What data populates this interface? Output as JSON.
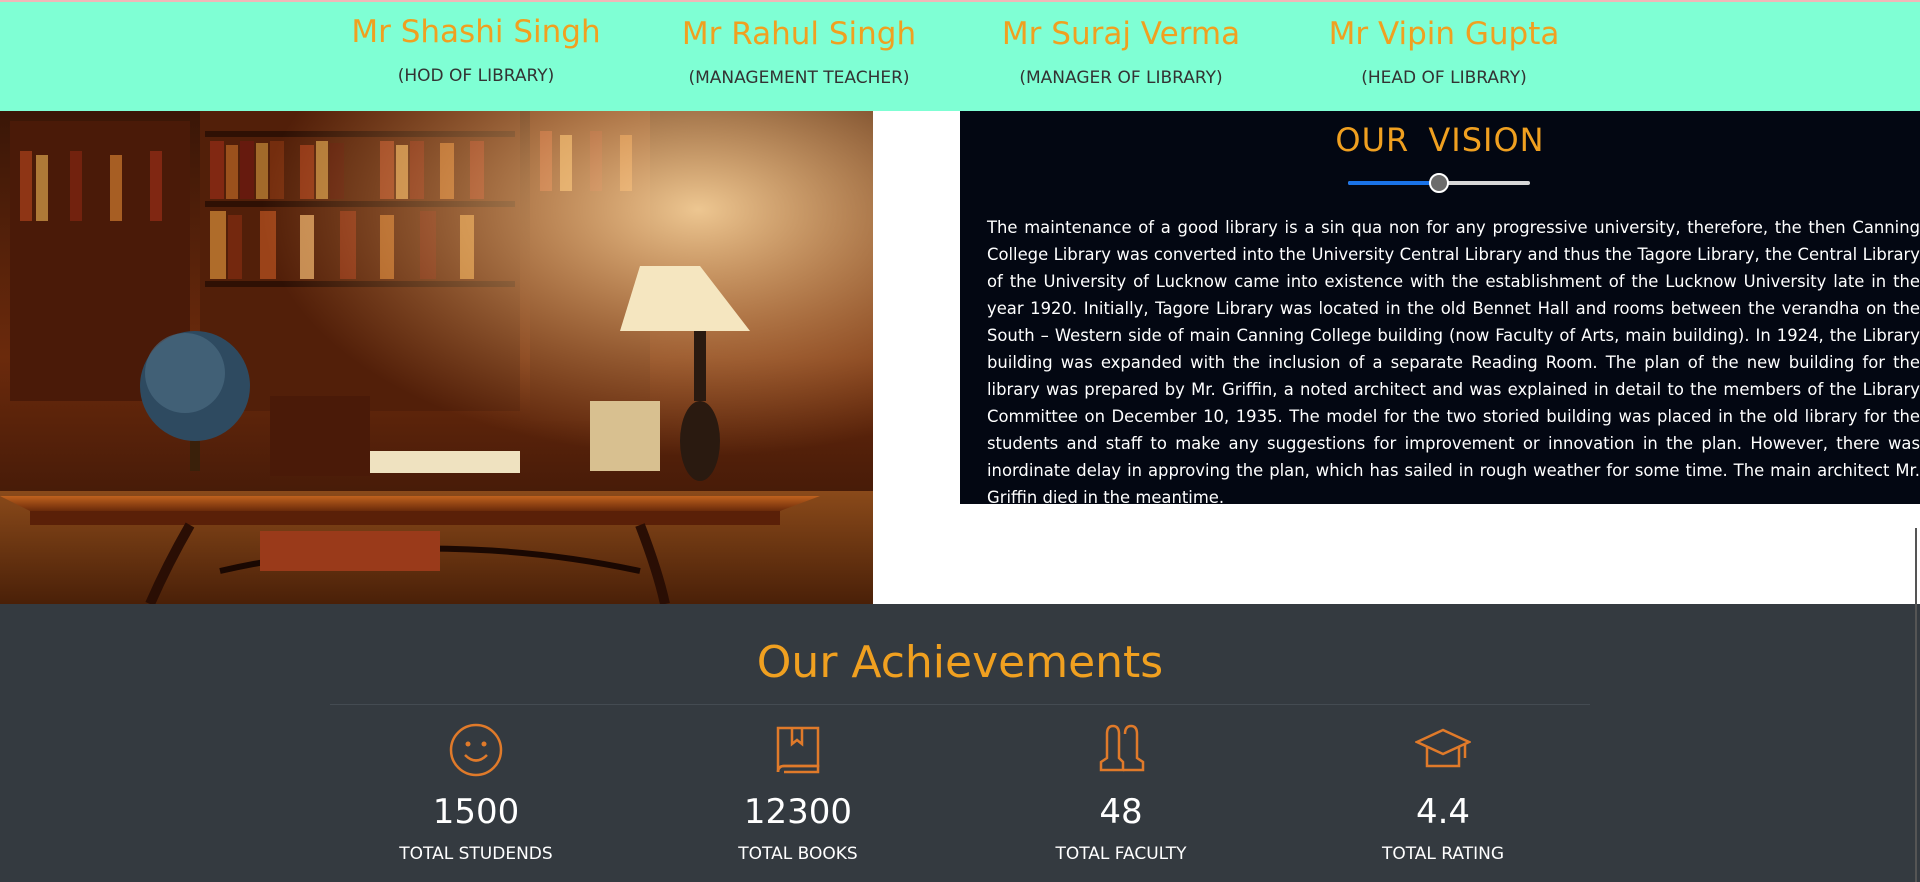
{
  "staff": [
    {
      "name": "Mr Shashi Singh",
      "role": "(HOD OF LIBRARY)"
    },
    {
      "name": "Mr Rahul Singh",
      "role": "(MANAGEMENT TEACHER)"
    },
    {
      "name": "Mr Suraj Verma",
      "role": "(MANAGER OF LIBRARY)"
    },
    {
      "name": "Mr Vipin Gupta",
      "role": "(HEAD OF LIBRARY)"
    }
  ],
  "vision": {
    "title": "OUR  VISION",
    "slider_fraction": 0.5,
    "text": "The maintenance of a good library is a sin qua non for any progressive university, therefore, the then Canning College Library was converted into the University Central Library and thus the Tagore Library, the Central Library of the University of Lucknow came into existence with the establishment of the Lucknow University late in the year 1920. Initially, Tagore Library was located in the old Bennet Hall and rooms between the verandha on the South – Western side of main Canning College building (now Faculty of Arts, main building). In 1924, the Library building was expanded with the inclusion of a separate Reading Room. The plan of the new building for the library was prepared by Mr. Griffin, a noted architect and was explained in detail to the members of the Library Committee on December 10, 1935. The model for the two storied building was placed in the old library for the students and staff to make any suggestions for improvement or innovation in the plan. However, there was inordinate delay in approving the plan, which has sailed in rough weather for some time. The main architect Mr. Griffin died in the meantime."
  },
  "achievements": {
    "title": "Our Achievements",
    "items": [
      {
        "icon": "smiley-face-icon",
        "value": "1500",
        "label": "TOTAL STUDENDS"
      },
      {
        "icon": "book-icon",
        "value": "12300",
        "label": "TOTAL BOOKS"
      },
      {
        "icon": "faculty-people-icon",
        "value": "48",
        "label": "TOTAL FACULTY"
      },
      {
        "icon": "graduation-cap-icon",
        "value": "4.4",
        "label": "TOTAL RATING"
      }
    ]
  },
  "colors": {
    "topbar": "#7fffd4",
    "accent": "#f0a020",
    "vision_bg": "#030712",
    "achievements_bg": "#343a40"
  }
}
